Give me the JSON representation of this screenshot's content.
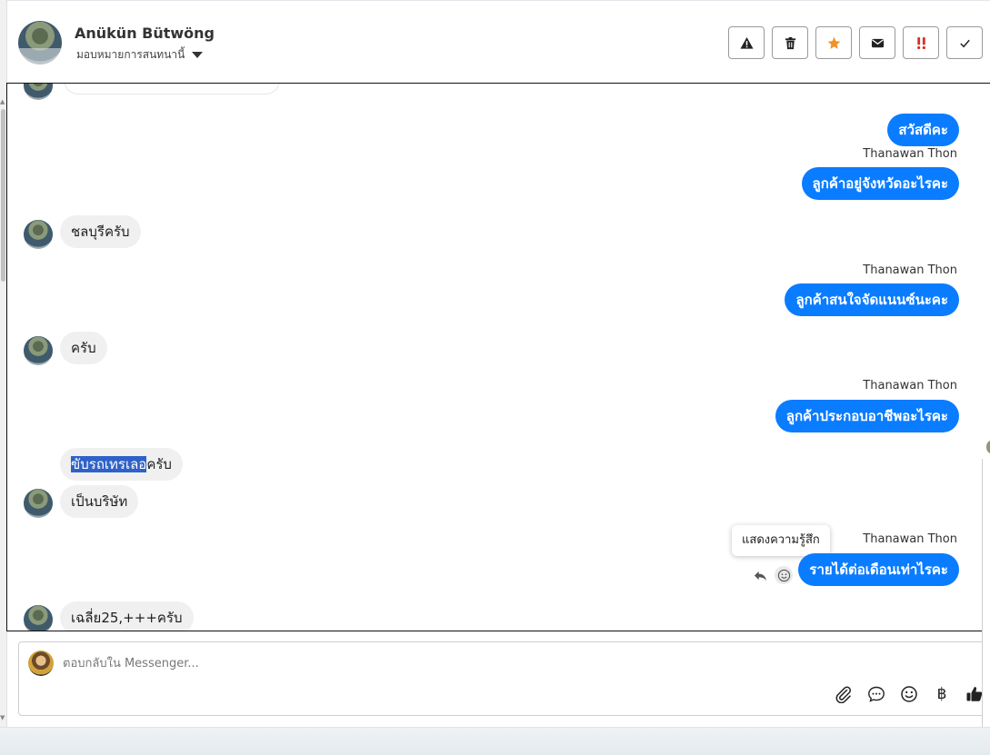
{
  "header": {
    "contact_name": "Anükün Bütwöng",
    "assign_label": "มอบหมายการสนทนานี้",
    "actions": [
      {
        "name": "warning",
        "color": "#222222"
      },
      {
        "name": "trash",
        "color": "#222222"
      },
      {
        "name": "star",
        "color": "#f0922b"
      },
      {
        "name": "envelope",
        "color": "#222222"
      },
      {
        "name": "urgent",
        "color": "#d93025"
      },
      {
        "name": "check",
        "color": "#222222"
      }
    ]
  },
  "colors": {
    "outgoing_bubble": "#0a7cff",
    "incoming_bubble": "#f0f0f0",
    "highlight": "#2f62c8"
  },
  "messages": [
    {
      "dir": "out",
      "text": "สวัสดีคะ"
    },
    {
      "dir": "out",
      "sender": "Thanawan Thon",
      "text": "ลูกค้าอยู่จังหวัดอะไรคะ"
    },
    {
      "dir": "in",
      "text": "ชลบุรีครับ"
    },
    {
      "dir": "out",
      "sender": "Thanawan Thon",
      "text": "ลูกค้าสนใจจัดแนนซ์นะคะ"
    },
    {
      "dir": "in",
      "text": "ครับ"
    },
    {
      "dir": "out",
      "sender": "Thanawan Thon",
      "text": "ลูกค้าประกอบอาชีพอะไรคะ"
    },
    {
      "dir": "in",
      "text_highlight": "ขับรถเทรเลอ",
      "text_rest": "ครับ"
    },
    {
      "dir": "in",
      "text": "เป็นบริษัท"
    },
    {
      "dir": "out",
      "sender": "Thanawan Thon",
      "text": "รายได้ต่อเดือนเท่าไรคะ"
    },
    {
      "dir": "in",
      "text": "เฉลี่ย25,+++ครับ"
    }
  ],
  "tooltip": "แสดงความรู้สึก",
  "composer": {
    "placeholder": "ตอบกลับใน Messenger...",
    "tools": [
      "paperclip-icon",
      "chat-bubble-icon",
      "emoji-icon",
      "baht-icon",
      "thumbs-up-icon"
    ],
    "baht_symbol": "฿"
  }
}
